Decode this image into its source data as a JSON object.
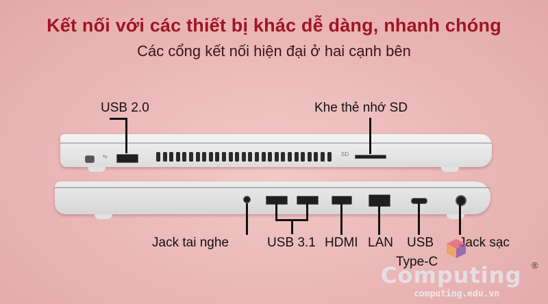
{
  "header": {
    "title": "Kết nối với các thiết bị khác dễ dàng, nhanh chóng",
    "subtitle": "Các cổng kết nối hiện đại ở hai cạnh bên"
  },
  "labels": {
    "usb20": "USB 2.0",
    "sd": "Khe thẻ nhớ SD",
    "jack_tai_nghe": "Jack tai nghe",
    "usb31": "USB 3.1",
    "hdmi": "HDMI",
    "lan": "LAN",
    "usb_c_line1": "USB",
    "usb_c_line2": "Type-C",
    "jack_sac": "Jack sạc"
  },
  "watermark": {
    "logo": "Computing",
    "url": "computing.edu.vn",
    "reg": "®"
  },
  "colors": {
    "title": "#a01423",
    "subtitle": "#3a1519",
    "background": "#eab6b6"
  }
}
